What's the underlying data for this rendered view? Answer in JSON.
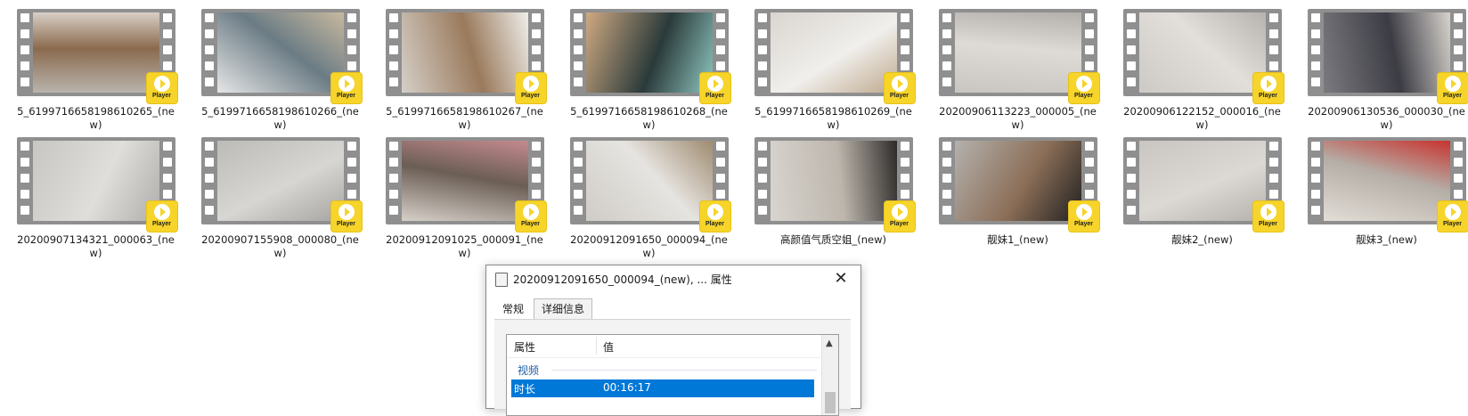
{
  "files": [
    {
      "name": "5_6199716658198610265_(new)",
      "badge": "Player",
      "colors": [
        "#b9b4ad",
        "#d9cfc6",
        "#8a6a4e"
      ]
    },
    {
      "name": "5_6199716658198610266_(new)",
      "badge": "Player",
      "colors": [
        "#e6e6e6",
        "#c8b99f",
        "#6b7c85"
      ]
    },
    {
      "name": "5_6199716658198610267_(new)",
      "badge": "Player",
      "colors": [
        "#d5cfc8",
        "#efeeea",
        "#9a7a5c"
      ]
    },
    {
      "name": "5_6199716658198610268_(new)",
      "badge": "Player",
      "colors": [
        "#cfa982",
        "#8fc7c0",
        "#2a3a3a"
      ]
    },
    {
      "name": "5_6199716658198610269_(new)",
      "badge": "Player",
      "colors": [
        "#dad5cf",
        "#bfa88d",
        "#f0efec"
      ]
    },
    {
      "name": "20200906113223_000005_(new)",
      "badge": "Player",
      "colors": [
        "#c9c6c1",
        "#b3b0ab",
        "#dedbd6"
      ]
    },
    {
      "name": "20200906122152_000016_(new)",
      "badge": "Player",
      "colors": [
        "#cdcac5",
        "#b6b3ae",
        "#e2dfda"
      ]
    },
    {
      "name": "20200906130536_000030_(new)",
      "badge": "Player",
      "colors": [
        "#7b7a80",
        "#d7d3cd",
        "#3c3c44"
      ]
    },
    {
      "name": "20200907134321_000063_(new)",
      "badge": "Player",
      "colors": [
        "#c8c6c2",
        "#b0aeab",
        "#e0dedb"
      ]
    },
    {
      "name": "20200907155908_000080_(new)",
      "badge": "Player",
      "colors": [
        "#bdbbb8",
        "#a6a4a1",
        "#d8d6d3"
      ]
    },
    {
      "name": "20200912091025_000091_(new)",
      "badge": "Player",
      "colors": [
        "#d6d0c9",
        "#c48a8f",
        "#6b5e55"
      ]
    },
    {
      "name": "20200912091650_000094_(new)",
      "badge": "Player",
      "colors": [
        "#cfccc7",
        "#9f8b70",
        "#e6e4e0"
      ]
    },
    {
      "name": "高颜值气质空姐_(new)",
      "badge": "Player",
      "colors": [
        "#d8d4cf",
        "#2d2a28",
        "#bdb6ad"
      ]
    },
    {
      "name": "靓妹1_(new)",
      "badge": "Player",
      "colors": [
        "#b4b1ad",
        "#202020",
        "#8b6e57"
      ]
    },
    {
      "name": "靓妹2_(new)",
      "badge": "Player",
      "colors": [
        "#c9c5c0",
        "#b5b1ac",
        "#dcd8d3"
      ]
    },
    {
      "name": "靓妹3_(new)",
      "badge": "Player",
      "colors": [
        "#e2ddd7",
        "#c8332f",
        "#b5aea6"
      ]
    }
  ],
  "dialog": {
    "title": "20200912091650_000094_(new), ... 属性",
    "close_glyph": "✕",
    "tabs": [
      {
        "label": "常规",
        "active": false
      },
      {
        "label": "详细信息",
        "active": true
      }
    ],
    "columns": {
      "property": "属性",
      "value": "值"
    },
    "group": "视频",
    "selected_row": {
      "property": "时长",
      "value": "00:16:17"
    },
    "scroll_up_glyph": "▲"
  }
}
